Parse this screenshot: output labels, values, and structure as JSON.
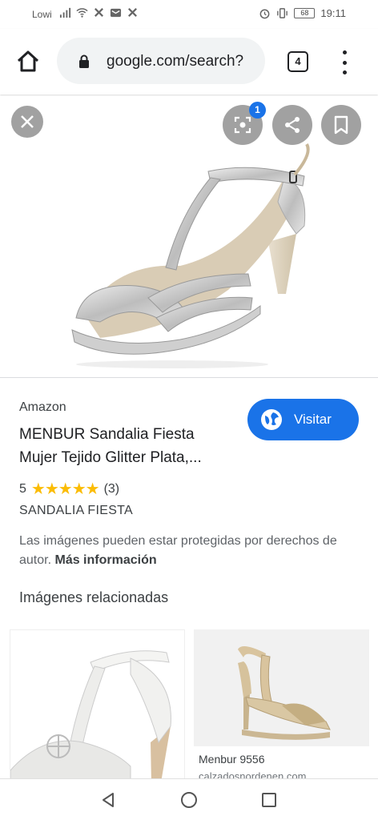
{
  "status_bar": {
    "carrier": "Lowi",
    "battery": "68",
    "time": "19:11",
    "icons": [
      "signal-icon",
      "wifi-icon",
      "notification-icon",
      "mail-icon",
      "notification-icon",
      "alarm-icon",
      "vibrate-icon"
    ]
  },
  "browser": {
    "url": "google.com/search?",
    "tab_count": "4"
  },
  "preview": {
    "lens_badge": "1"
  },
  "result": {
    "source": "Amazon",
    "title": "MENBUR Sandalia Fiesta Mujer Tejido Glitter Plata,...",
    "visit_label": "Visitar",
    "rating_value": "5",
    "rating_count": "(3)",
    "stars": 5,
    "category": "SANDALIA FIESTA",
    "notice_text": "Las imágenes pueden estar protegidas por derechos de autor.",
    "notice_link": "Más información"
  },
  "related": {
    "heading": "Imágenes relacionadas",
    "items": [
      {
        "caption": "",
        "subcaption": ""
      },
      {
        "caption": "Menbur 9556",
        "subcaption": "calzadosnordenen.com"
      }
    ]
  },
  "colors": {
    "accent": "#1a73e8",
    "star": "#fbbc04"
  }
}
